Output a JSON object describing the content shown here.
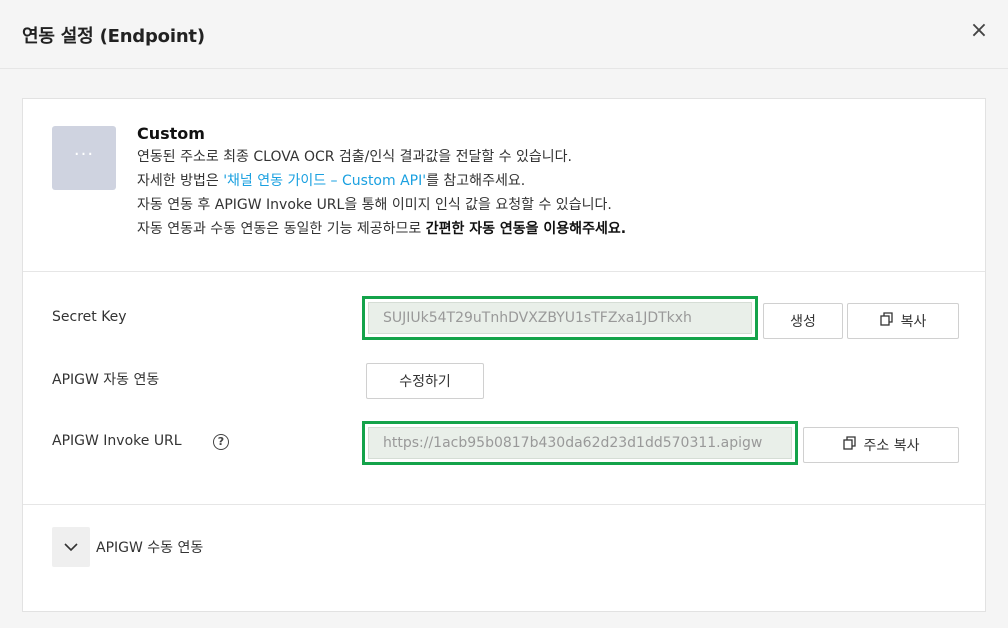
{
  "header": {
    "title": "연동 설정 (Endpoint)",
    "close_glyph": "×"
  },
  "info": {
    "icon_glyph": "···",
    "heading": "Custom",
    "line1": "연동된 주소로 최종 CLOVA OCR 검출/인식 결과값을 전달할 수 있습니다.",
    "line2_prefix": "자세한 방법은 ",
    "line2_link": "'채널 연동 가이드 – Custom API'",
    "line2_suffix": "를 참고해주세요.",
    "line3": "자동 연동 후 APIGW Invoke URL을 통해 이미지 인식 값을 요청할 수 있습니다.",
    "line4_prefix": "자동 연동과 수동 연동은 동일한 기능 제공하므로 ",
    "line4_bold": "간편한 자동 연동을 이용해주세요.",
    "link_color": "#1aa0e0"
  },
  "secret_key": {
    "label": "Secret Key",
    "value": "SUJIUk54T29uTnhDVXZBYU1sTFZxa1JDTkxh",
    "generate_label": "생성",
    "copy_label": "복사"
  },
  "apigw_auto": {
    "label": "APIGW 자동 연동",
    "edit_label": "수정하기"
  },
  "invoke_url": {
    "label": "APIGW Invoke URL",
    "help_glyph": "?",
    "value": "https://1acb95b0817b430da62d23d1dd570311.apigw",
    "copy_label": "주소 복사"
  },
  "manual": {
    "label": "APIGW 수동 연동"
  },
  "colors": {
    "highlight_border": "#14a34a",
    "icon_box_bg": "#cfd3e0"
  }
}
